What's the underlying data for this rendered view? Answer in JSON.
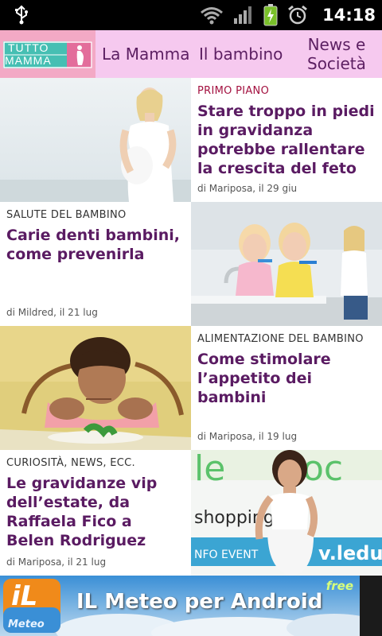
{
  "status_bar": {
    "time": "14:18",
    "icons": [
      "usb-icon",
      "wifi-icon",
      "signal-icon",
      "battery-charging-icon",
      "alarm-icon"
    ]
  },
  "nav": {
    "logo_line1": "TUTTO",
    "logo_line2": "MAMMA",
    "items": [
      {
        "label": "La Mamma"
      },
      {
        "label": "Il bambino"
      },
      {
        "label_line1": "News e",
        "label_line2": "Società"
      }
    ]
  },
  "articles": [
    {
      "category": "PRIMO PIANO",
      "title": "Stare troppo in piedi in gravidanza potrebbe rallentare la crescita del feto",
      "meta": "di Mariposa, il 29 giu",
      "image": "pregnant-woman-photo"
    },
    {
      "category": "SALUTE DEL BAMBINO",
      "title": "Carie denti bambini, come prevenirla",
      "meta": "di Mildred, il 21 lug",
      "image": "children-brushing-teeth-photo"
    },
    {
      "category": "ALIMENTAZIONE DEL BAMBINO",
      "title": "Come stimolare l’appetito dei bambini",
      "meta": "di Mariposa, il 19 lug",
      "image": "child-refusing-food-photo"
    },
    {
      "category": "CURIOSITÀ, NEWS, ECC.",
      "title": "Le gravidanze vip dell’estate, da Raffaela Fico a Belen Rodriguez",
      "meta": "di Mariposa, il 21 lug",
      "image": "celebrity-pregnant-event-photo"
    }
  ],
  "ad": {
    "logo_mark": "iL",
    "logo_text": "Meteo",
    "title": "IL Meteo per Android",
    "badge": "free"
  },
  "colors": {
    "nav_bg": "#f6c9ef",
    "headline": "#5a1b62",
    "category_primo": "#a31140"
  }
}
